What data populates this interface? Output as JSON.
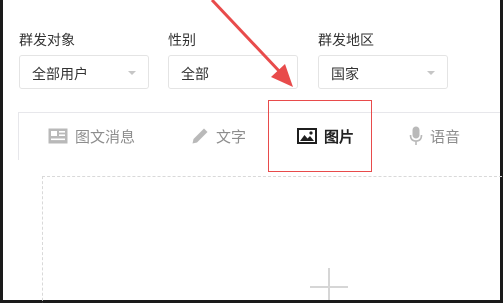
{
  "filters": {
    "target": {
      "label": "群发对象",
      "value": "全部用户"
    },
    "gender": {
      "label": "性别",
      "value": "全部"
    },
    "region": {
      "label": "群发地区",
      "value": "国家"
    }
  },
  "tabs": [
    {
      "label": "图文消息",
      "icon": "news-icon",
      "active": false
    },
    {
      "label": "文字",
      "icon": "pen-icon",
      "active": false
    },
    {
      "label": "图片",
      "icon": "image-icon",
      "active": true
    },
    {
      "label": "语音",
      "icon": "microphone-icon",
      "active": false
    }
  ],
  "annotation": {
    "color": "#e84b4b"
  },
  "upload": {
    "icon": "plus-icon"
  }
}
